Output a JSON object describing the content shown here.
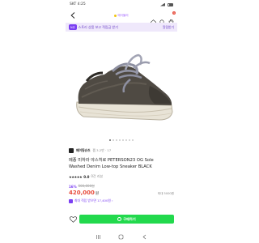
{
  "status": {
    "carrier_time": "SKT 4:25"
  },
  "nav": {
    "logo_text": "에이블리"
  },
  "cart": {
    "count": "1"
  },
  "banner": {
    "tag": "N쿠",
    "text": "스토리 상품 보고 적립금 받기",
    "more": "알림받기"
  },
  "brand": {
    "name": "메이띵슈즈",
    "likes": "찜 3.2만 · 17"
  },
  "product": {
    "title_line1": "메종 미하라 야스히로 PETERSON23 OG Sole",
    "title_line2": "Washed Denim Low-top Sneaker BLACK",
    "stars": "★★★★★",
    "score": "0.0",
    "reviews": "0건 리뷰"
  },
  "price": {
    "discount_rate": "16%",
    "original": "500,000원",
    "current": "420,000",
    "currency": "원",
    "min_order": "최대 5000원"
  },
  "points": {
    "text": "최대 적립 받으면 17,400원 ›"
  },
  "actions": {
    "buy": "구매하기"
  },
  "colors": {
    "accent": "#7b3ff2",
    "price": "#e74c3c",
    "buy": "#22d94d"
  },
  "carousel": {
    "count": 8,
    "active_index": 0
  }
}
